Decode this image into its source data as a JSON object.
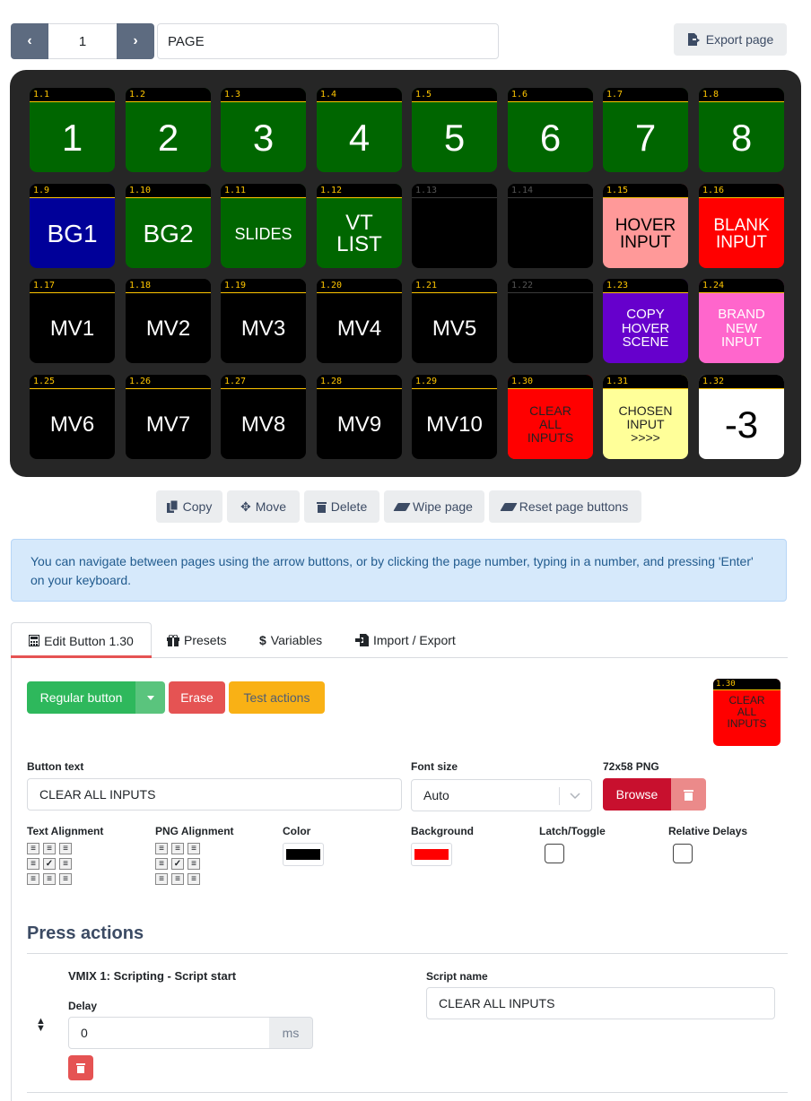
{
  "pager": {
    "prev_glyph": "‹",
    "next_glyph": "›",
    "page_number": "1",
    "page_name": "PAGE",
    "export_label": "Export page"
  },
  "grid": {
    "buttons": [
      {
        "id": "1.1",
        "text": "1",
        "bg": "#006600",
        "fg": "#ffffff",
        "size": 42
      },
      {
        "id": "1.2",
        "text": "2",
        "bg": "#006600",
        "fg": "#ffffff",
        "size": 42
      },
      {
        "id": "1.3",
        "text": "3",
        "bg": "#006600",
        "fg": "#ffffff",
        "size": 42
      },
      {
        "id": "1.4",
        "text": "4",
        "bg": "#006600",
        "fg": "#ffffff",
        "size": 42
      },
      {
        "id": "1.5",
        "text": "5",
        "bg": "#006600",
        "fg": "#ffffff",
        "size": 42
      },
      {
        "id": "1.6",
        "text": "6",
        "bg": "#006600",
        "fg": "#ffffff",
        "size": 42
      },
      {
        "id": "1.7",
        "text": "7",
        "bg": "#006600",
        "fg": "#ffffff",
        "size": 42
      },
      {
        "id": "1.8",
        "text": "8",
        "bg": "#006600",
        "fg": "#ffffff",
        "size": 42
      },
      {
        "id": "1.9",
        "text": "BG1",
        "bg": "#000099",
        "fg": "#ffffff",
        "size": 28
      },
      {
        "id": "1.10",
        "text": "BG2",
        "bg": "#006600",
        "fg": "#ffffff",
        "size": 28
      },
      {
        "id": "1.11",
        "text": "SLIDES",
        "bg": "#006600",
        "fg": "#ffffff",
        "size": 18
      },
      {
        "id": "1.12",
        "text": "VT\nLIST",
        "bg": "#006600",
        "fg": "#ffffff",
        "size": 24
      },
      {
        "id": "1.13",
        "text": "",
        "bg": "#000000",
        "fg": "#ffffff",
        "size": 18,
        "empty": true
      },
      {
        "id": "1.14",
        "text": "",
        "bg": "#000000",
        "fg": "#ffffff",
        "size": 18,
        "empty": true
      },
      {
        "id": "1.15",
        "text": "HOVER\nINPUT",
        "bg": "#ff9999",
        "fg": "#000000",
        "size": 19
      },
      {
        "id": "1.16",
        "text": "BLANK\nINPUT",
        "bg": "#ff0000",
        "fg": "#ffffff",
        "size": 19
      },
      {
        "id": "1.17",
        "text": "MV1",
        "bg": "#000000",
        "fg": "#ffffff",
        "size": 24
      },
      {
        "id": "1.18",
        "text": "MV2",
        "bg": "#000000",
        "fg": "#ffffff",
        "size": 24
      },
      {
        "id": "1.19",
        "text": "MV3",
        "bg": "#000000",
        "fg": "#ffffff",
        "size": 24
      },
      {
        "id": "1.20",
        "text": "MV4",
        "bg": "#000000",
        "fg": "#ffffff",
        "size": 24
      },
      {
        "id": "1.21",
        "text": "MV5",
        "bg": "#000000",
        "fg": "#ffffff",
        "size": 24
      },
      {
        "id": "1.22",
        "text": "",
        "bg": "#000000",
        "fg": "#ffffff",
        "size": 18,
        "empty": true
      },
      {
        "id": "1.23",
        "text": "COPY\nHOVER\nSCENE",
        "bg": "#6600cc",
        "fg": "#ffffff",
        "size": 15
      },
      {
        "id": "1.24",
        "text": "BRAND\nNEW\nINPUT",
        "bg": "#ff66cc",
        "fg": "#ffffff",
        "size": 15
      },
      {
        "id": "1.25",
        "text": "MV6",
        "bg": "#000000",
        "fg": "#ffffff",
        "size": 24
      },
      {
        "id": "1.26",
        "text": "MV7",
        "bg": "#000000",
        "fg": "#ffffff",
        "size": 24
      },
      {
        "id": "1.27",
        "text": "MV8",
        "bg": "#000000",
        "fg": "#ffffff",
        "size": 24
      },
      {
        "id": "1.28",
        "text": "MV9",
        "bg": "#000000",
        "fg": "#ffffff",
        "size": 24
      },
      {
        "id": "1.29",
        "text": "MV10",
        "bg": "#000000",
        "fg": "#ffffff",
        "size": 24
      },
      {
        "id": "1.30",
        "text": "CLEAR\nALL\nINPUTS",
        "bg": "#ff0000",
        "fg": "#222222",
        "size": 14,
        "selected": true
      },
      {
        "id": "1.31",
        "text": "CHOSEN\nINPUT\n>>>>",
        "bg": "#ffff99",
        "fg": "#222222",
        "size": 14
      },
      {
        "id": "1.32",
        "text": "-3",
        "bg": "#ffffff",
        "fg": "#000000",
        "size": 42
      }
    ]
  },
  "actions": {
    "copy": "Copy",
    "move": "Move",
    "delete": "Delete",
    "wipe": "Wipe page",
    "reset": "Reset page buttons"
  },
  "alert": {
    "text": "You can navigate between pages using the arrow buttons, or by clicking the page number, typing in a number, and pressing 'Enter' on your keyboard."
  },
  "tabs": {
    "edit": "Edit Button 1.30",
    "presets": "Presets",
    "variables": "Variables",
    "import_export": "Import / Export"
  },
  "edit": {
    "type_label": "Regular button",
    "erase_label": "Erase",
    "test_label": "Test actions",
    "preview": {
      "id": "1.30",
      "text": "CLEAR\nALL\nINPUTS"
    },
    "button_text_label": "Button text",
    "button_text_value": "CLEAR ALL INPUTS",
    "font_size_label": "Font size",
    "font_size_value": "Auto",
    "png_label": "72x58 PNG",
    "browse_label": "Browse",
    "text_alignment_label": "Text Alignment",
    "png_alignment_label": "PNG Alignment",
    "color_label": "Color",
    "color_value": "#000000",
    "background_label": "Background",
    "background_value": "#ff0000",
    "latch_label": "Latch/Toggle",
    "relative_delays_label": "Relative Delays"
  },
  "press_actions": {
    "heading": "Press actions",
    "items": [
      {
        "title": "VMIX 1: Scripting - Script start",
        "delay_label": "Delay",
        "delay_value": "0",
        "delay_unit": "ms",
        "script_name_label": "Script name",
        "script_name_value": "CLEAR ALL INPUTS"
      }
    ]
  }
}
